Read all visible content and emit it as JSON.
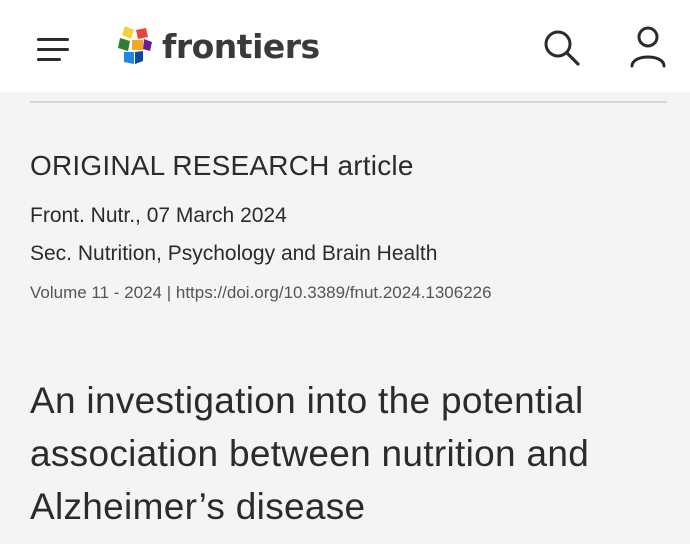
{
  "header": {
    "logo_text": "frontiers",
    "menu_icon": "hamburger-menu-icon",
    "search_icon": "search-icon",
    "account_icon": "user-icon",
    "logo_colors": [
      "#f5a623",
      "#e8443a",
      "#2e7d32",
      "#1e88e5",
      "#6a1b9a",
      "#f2d13a"
    ]
  },
  "article": {
    "type": "ORIGINAL RESEARCH article",
    "journal_date": "Front. Nutr., 07 March 2024",
    "section": "Sec. Nutrition, Psychology and Brain Health",
    "volume": "Volume 11 - 2024",
    "separator": " | ",
    "doi": "https://doi.org/10.3389/fnut.2024.1306226",
    "title": "An investigation into the potential association between nutrition and Alzheimer’s disease"
  }
}
